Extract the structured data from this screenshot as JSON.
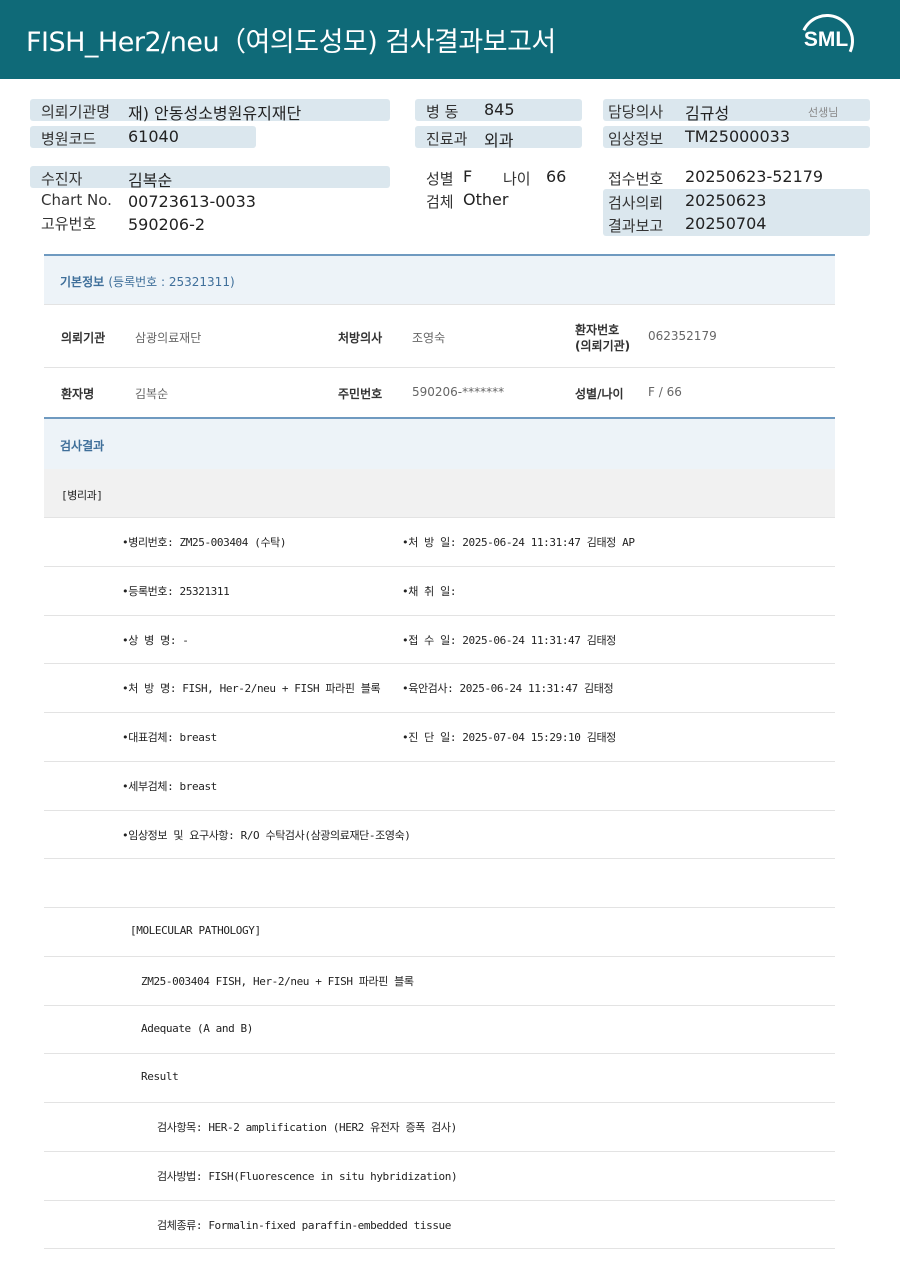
{
  "header": {
    "title": "FISH_Her2/neu（여의도성모) 검사결과보고서",
    "logo": "SML"
  },
  "info": {
    "requesting_org_label": "의뢰기관명",
    "requesting_org": "재) 안동성소병원유지재단",
    "hospital_code_label": "병원코드",
    "hospital_code": "61040",
    "ward_label": "병  동",
    "ward": "845",
    "dept_label": "진료과",
    "dept": "외과",
    "doctor_label": "담당의사",
    "doctor": "김규성",
    "doctor_suffix": "선생님",
    "clinical_label": "임상정보",
    "clinical": "TM25000033",
    "patient_label": "수진자",
    "patient": "김복순",
    "chart_label": "Chart No.",
    "chart": "00723613-0033",
    "unique_label": "고유번호",
    "unique": "590206-2",
    "sex_label": "성별",
    "sex": "F",
    "age_label": "나이",
    "age": "66",
    "specimen_label": "검체",
    "specimen": "Other",
    "receipt_label": "접수번호",
    "receipt": "20250623-52179",
    "request_date_label": "검사의뢰",
    "request_date": "20250623",
    "report_date_label": "결과보고",
    "report_date": "20250704"
  },
  "basic": {
    "title": "기본정보",
    "reg": "(등록번호 : 25321311)",
    "org_label": "의뢰기관",
    "org": "삼광의료재단",
    "prescriber_label": "처방의사",
    "prescriber": "조영숙",
    "patno_label_1": "환자번호",
    "patno_label_2": "(의뢰기관)",
    "patno": "062352179",
    "name_label": "환자명",
    "name": "김복순",
    "rrn_label": "주민번호",
    "rrn": "590206-*******",
    "sexage_label": "성별/나이",
    "sexage": "F / 66"
  },
  "result": {
    "title": "검사결과",
    "section": "[병리과]",
    "lines_left": [
      "•병리번호: ZM25-003404 (수탁)",
      "•등록번호: 25321311",
      "•상 병 명: -",
      "•처 방 명: FISH, Her-2/neu + FISH 파라핀 블록",
      "•대표검체: breast",
      "•세부검체: breast",
      "•임상정보 및 요구사항: R/O 수탁검사(삼광의료재단-조영숙)"
    ],
    "lines_right": [
      "•처 방 일: 2025-06-24 11:31:47  김태정 AP",
      "•채 취 일:",
      "•접 수 일: 2025-06-24 11:31:47  김태정",
      "•육안검사: 2025-06-24 11:31:47  김태정",
      "•진 단 일: 2025-07-04 15:29:10  김태정"
    ],
    "molecular": [
      "[MOLECULAR PATHOLOGY]",
      "ZM25-003404     FISH, Her-2/neu + FISH 파라핀 블록",
      "Adequate (A and B)",
      "Result",
      "검사항목: HER-2 amplification (HER2 유전자 증폭 검사)",
      "검사방법: FISH(Fluorescence in situ hybridization)",
      "검체종류: Formalin-fixed paraffin-embedded tissue"
    ]
  }
}
